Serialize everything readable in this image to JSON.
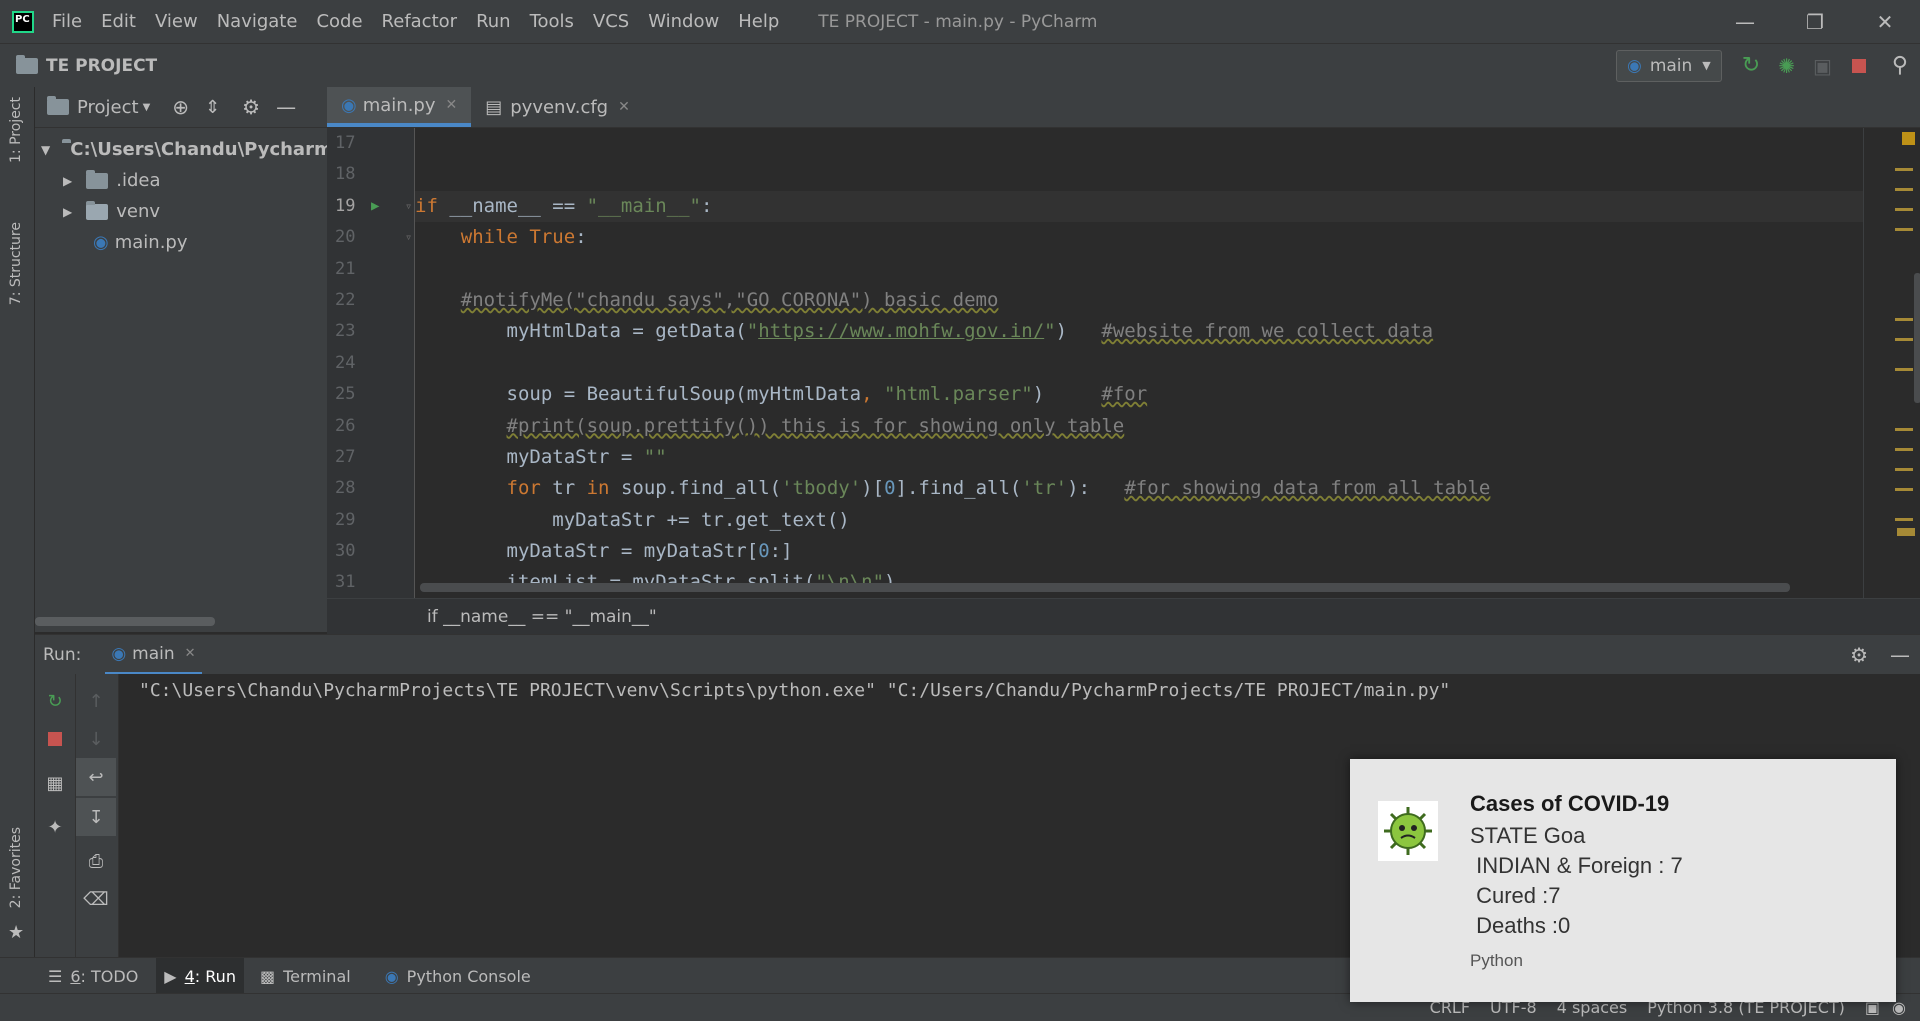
{
  "titlebar": {
    "menu": [
      "File",
      "Edit",
      "View",
      "Navigate",
      "Code",
      "Refactor",
      "Run",
      "Tools",
      "VCS",
      "Window",
      "Help"
    ],
    "window_title": "TE PROJECT - main.py - PyCharm",
    "logo_text": "PC"
  },
  "navbar": {
    "project_name": "TE PROJECT",
    "run_config": "main"
  },
  "left_strip": {
    "tab_project": "1: Project",
    "tab_structure": "7: Structure",
    "tab_favorites": "2: Favorites"
  },
  "project_panel": {
    "header": "Project",
    "root": "C:\\Users\\Chandu\\PycharmP",
    "items": [
      ".idea",
      "venv",
      "main.py"
    ]
  },
  "editor": {
    "tabs": [
      "main.py",
      "pyvenv.cfg"
    ],
    "line_numbers": [
      "17",
      "18",
      "19",
      "20",
      "21",
      "22",
      "23",
      "24",
      "25",
      "26",
      "27",
      "28",
      "29",
      "30",
      "31"
    ],
    "code": {
      "l19_kw": "if",
      "l19_a": " __name__ == ",
      "l19_str": "\"__main__\"",
      "l19_b": ":",
      "l20_kw": "while",
      "l20_kw2": "True",
      "l20_b": ":",
      "l22_cm": "#notifyMe(\"chandu says\",\"GO CORONA\") basic demo",
      "l23_a": "myHtmlData = getData(",
      "l23_q1": "\"",
      "l23_url": "https://www.mohfw.gov.in/",
      "l23_q2": "\"",
      "l23_b": ")   ",
      "l23_cm": "#website from we collect data",
      "l25_a": "soup = BeautifulSoup(myHtmlData",
      "l25_comma": ", ",
      "l25_str": "\"html.parser\"",
      "l25_b": ")     ",
      "l25_cm": "#for",
      "l26_cm": "#print(soup.prettify()) this is for showing only table",
      "l27_a": "myDataStr = ",
      "l27_str": "\"\"",
      "l28_kw": "for",
      "l28_a": " tr ",
      "l28_kw2": "in",
      "l28_b": " soup.find_all(",
      "l28_s1": "'tbody'",
      "l28_c": ")[",
      "l28_n": "0",
      "l28_d": "].find_all(",
      "l28_s2": "'tr'",
      "l28_e": "):   ",
      "l28_cm": "#for showing data from all table",
      "l29_a": "myDataStr += tr.get_text()",
      "l30_a": "myDataStr = myDataStr[",
      "l30_n": "0",
      "l30_b": ":]",
      "l31_a": "itemList = myDataStr.split(",
      "l31_str": "\"\\n\\n\"",
      "l31_b": ")"
    },
    "breadcrumb": "if __name__ == \"__main__\""
  },
  "run_panel": {
    "label": "Run:",
    "tab": "main",
    "output": "\"C:\\Users\\Chandu\\PycharmProjects\\TE PROJECT\\venv\\Scripts\\python.exe\" \"C:/Users/Chandu/PycharmProjects/TE PROJECT/main.py\""
  },
  "bottom_tabs": [
    {
      "num": "6",
      "label": ": TODO"
    },
    {
      "num": "4",
      "label": ": Run"
    },
    {
      "num": "",
      "label": "Terminal"
    },
    {
      "num": "",
      "label": "Python Console"
    }
  ],
  "statusbar": {
    "line_sep": "CRLF",
    "encoding": "UTF-8",
    "indent": "4 spaces",
    "interpreter": "Python 3.8 (TE PROJECT)"
  },
  "notification": {
    "title": "Cases of COVID-19",
    "lines": [
      "STATE Goa",
      " INDIAN & Foreign : 7",
      " Cured :7",
      " Deaths :0"
    ],
    "source": "Python"
  },
  "colors": {
    "accent": "#4a88c7",
    "run_green": "#499c54",
    "stop_red": "#c75450"
  }
}
